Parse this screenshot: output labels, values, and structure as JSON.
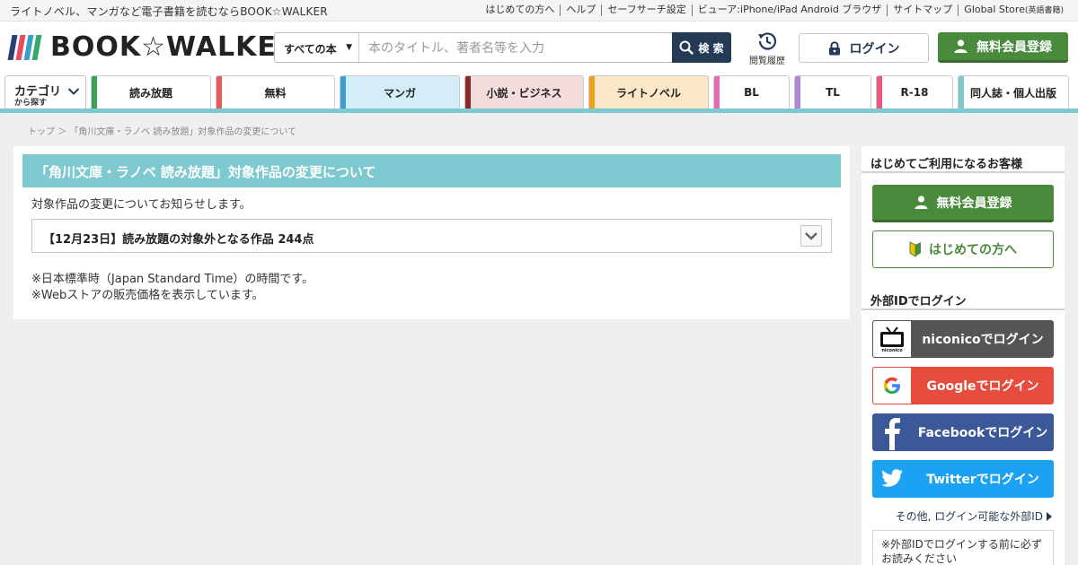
{
  "topbar": {
    "tagline": "ライトノベル、マンガなど電子書籍を読むならBOOK☆WALKER",
    "links": [
      {
        "label": "はじめての方へ"
      },
      {
        "label": "ヘルプ"
      },
      {
        "label": "セーフサーチ設定"
      },
      {
        "label": "ビューア:iPhone/iPad Android ブラウザ"
      },
      {
        "label": "サイトマップ"
      },
      {
        "label": "Global Store",
        "suffix": "(英語書籍)"
      }
    ]
  },
  "header": {
    "logo_text": "BOOK☆WALKER",
    "logo_colors": [
      "#2c3e7a",
      "#e84a5f",
      "#3aa0c7",
      "#38a86a"
    ],
    "search": {
      "category": "すべての本",
      "placeholder": "本のタイトル、著者名等を入力",
      "button_label": "検 索"
    },
    "history_label": "閲覧履歴",
    "login_label": "ログイン",
    "register_label": "無料会員登録"
  },
  "nav": {
    "category_menu": {
      "line1": "カテゴリ",
      "line2": "から探す"
    },
    "tabs": [
      {
        "label": "読み放題",
        "color": "#3aa05a",
        "bg": "#ffffff"
      },
      {
        "label": "無料",
        "color": "#e85a5a",
        "bg": "#ffffff"
      },
      {
        "label": "マンガ",
        "color": "#3aa0d0",
        "bg": "#d4edf7"
      },
      {
        "label": "小説・ビジネス",
        "color": "#8a2a2a",
        "bg": "#f4dcdc"
      },
      {
        "label": "ライトノベル",
        "color": "#f0a020",
        "bg": "#fbe7c8"
      },
      {
        "label": "BL",
        "color": "#e868b8",
        "bg": "#ffffff"
      },
      {
        "label": "TL",
        "color": "#b088d8",
        "bg": "#ffffff"
      },
      {
        "label": "R-18",
        "color": "#e85a7a",
        "bg": "#ffffff"
      },
      {
        "label": "同人誌・個人出版",
        "color": "#7ec9cf",
        "bg": "#ffffff"
      }
    ]
  },
  "breadcrumb": "トップ ＞ 「角川文庫・ラノベ 読み放題」対象作品の変更について",
  "main": {
    "title": "「角川文庫・ラノベ 読み放題」対象作品の変更について",
    "intro": "対象作品の変更についてお知らせします。",
    "accordion_label": "【12月23日】読み放題の対象外となる作品 244点",
    "notes": [
      "※日本標準時（Japan Standard Time）の時間です。",
      "※Webストアの販売価格を表示しています。"
    ]
  },
  "sidebar": {
    "first_visit_heading": "はじめてご利用になるお客様",
    "register_label": "無料会員登録",
    "first_guide_label": "はじめての方へ",
    "external_heading": "外部IDでログイン",
    "niconico_label": "niconicoでログイン",
    "google_label": "Googleでログイン",
    "facebook_label": "Facebookでログイン",
    "twitter_label": "Twitterでログイン",
    "other_ids_label": "その他, ログイン可能な外部ID",
    "notice_text": "※外部IDでログインする前に必ずお読みください"
  }
}
